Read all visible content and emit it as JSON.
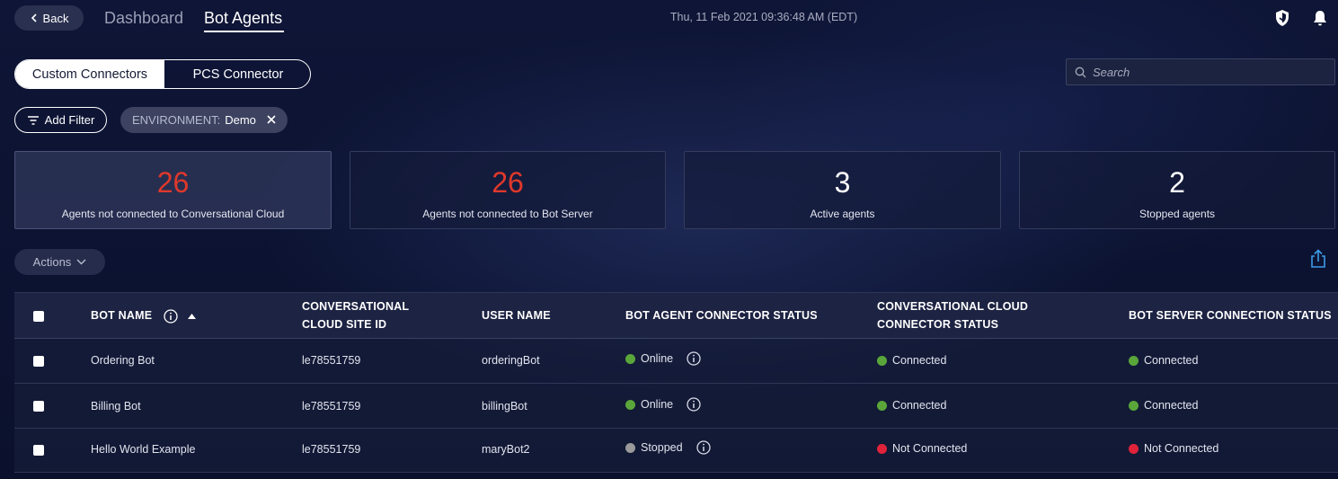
{
  "header": {
    "back_label": "Back",
    "nav": [
      {
        "label": "Dashboard"
      },
      {
        "label": "Bot Agents"
      }
    ],
    "datetime": "Thu, 11 Feb 2021 09:36:48 AM (EDT)"
  },
  "connector_toggle": [
    "Custom Connectors",
    "PCS Connector"
  ],
  "search": {
    "placeholder": "Search"
  },
  "filters": {
    "add_label": "Add Filter",
    "chip_key": "ENVIRONMENT:",
    "chip_value": "Demo"
  },
  "stats": [
    {
      "value": "26",
      "label": "Agents not connected to Conversational Cloud",
      "color": "#e0382b"
    },
    {
      "value": "26",
      "label": "Agents not connected to Bot Server",
      "color": "#e0382b"
    },
    {
      "value": "3",
      "label": "Active agents",
      "color": "#ffffff"
    },
    {
      "value": "2",
      "label": "Stopped agents",
      "color": "#ffffff"
    }
  ],
  "actions_label": "Actions",
  "table": {
    "headers": {
      "bot_name": "BOT NAME",
      "site_id_1": "CONVERSATIONAL",
      "site_id_2": "CLOUD SITE ID",
      "user_name": "USER NAME",
      "agent_status": "BOT AGENT CONNECTOR STATUS",
      "cc_status_1": "CONVERSATIONAL CLOUD",
      "cc_status_2": "CONNECTOR STATUS",
      "bs_status": "BOT SERVER CONNECTION STATUS"
    },
    "rows": [
      {
        "bot_name": "Ordering Bot",
        "site_id": "le78551759",
        "user_name": "orderingBot",
        "agent_status": "Online",
        "cc_status": "Connected",
        "bs_status": "Connected"
      },
      {
        "bot_name": "Billing Bot",
        "site_id": "le78551759",
        "user_name": "billingBot",
        "agent_status": "Online",
        "cc_status": "Connected",
        "bs_status": "Connected"
      },
      {
        "bot_name": "Hello World Example",
        "site_id": "le78551759",
        "user_name": "maryBot2",
        "agent_status": "Stopped",
        "cc_status": "Not Connected",
        "bs_status": "Not Connected"
      }
    ]
  },
  "colors": {
    "online": "#5aa63a",
    "stopped": "#9a9a9a",
    "error": "#e0233a"
  }
}
